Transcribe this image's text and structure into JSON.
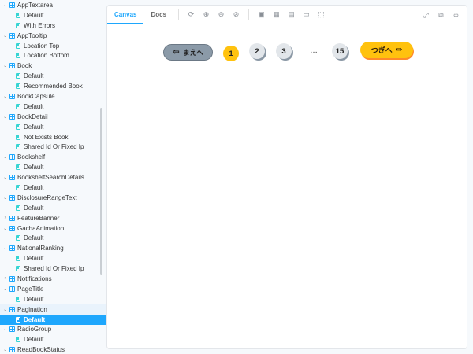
{
  "sidebar": {
    "items": [
      {
        "type": "component",
        "label": "AppTextarea"
      },
      {
        "type": "story",
        "label": "Default"
      },
      {
        "type": "story",
        "label": "With Errors"
      },
      {
        "type": "component",
        "label": "AppTooltip"
      },
      {
        "type": "story",
        "label": "Location Top"
      },
      {
        "type": "story",
        "label": "Location Bottom"
      },
      {
        "type": "component",
        "label": "Book"
      },
      {
        "type": "story",
        "label": "Default"
      },
      {
        "type": "story",
        "label": "Recommended Book"
      },
      {
        "type": "component",
        "label": "BookCapsule"
      },
      {
        "type": "story",
        "label": "Default"
      },
      {
        "type": "component",
        "label": "BookDetail"
      },
      {
        "type": "story",
        "label": "Default"
      },
      {
        "type": "story",
        "label": "Not Exists Book"
      },
      {
        "type": "story",
        "label": "Shared Id Or Fixed Ip"
      },
      {
        "type": "component",
        "label": "Bookshelf"
      },
      {
        "type": "story",
        "label": "Default"
      },
      {
        "type": "component",
        "label": "BookshelfSearchDetails"
      },
      {
        "type": "story",
        "label": "Default"
      },
      {
        "type": "component",
        "label": "DisclosureRangeText"
      },
      {
        "type": "story",
        "label": "Default"
      },
      {
        "type": "component",
        "label": "FeatureBanner",
        "collapsed": true
      },
      {
        "type": "component",
        "label": "GachaAnimation"
      },
      {
        "type": "story",
        "label": "Default"
      },
      {
        "type": "component",
        "label": "NationalRanking"
      },
      {
        "type": "story",
        "label": "Default"
      },
      {
        "type": "story",
        "label": "Shared Id Or Fixed Ip"
      },
      {
        "type": "component",
        "label": "Notifications",
        "collapsed": true
      },
      {
        "type": "component",
        "label": "PageTitle"
      },
      {
        "type": "story",
        "label": "Default"
      },
      {
        "type": "component",
        "label": "Pagination",
        "active": true
      },
      {
        "type": "story",
        "label": "Default",
        "selected": true
      },
      {
        "type": "component",
        "label": "RadioGroup"
      },
      {
        "type": "story",
        "label": "Default"
      },
      {
        "type": "component",
        "label": "ReadBookStatus"
      }
    ]
  },
  "toolbar": {
    "tabs": [
      {
        "label": "Canvas",
        "active": true
      },
      {
        "label": "Docs",
        "active": false
      }
    ],
    "tools": [
      "refresh-icon",
      "zoom-in-icon",
      "zoom-out-icon",
      "zoom-reset-icon",
      "background-icon",
      "grid-icon",
      "viewport-icon",
      "measure-icon",
      "outline-icon"
    ],
    "right_tools": [
      "fullscreen-icon",
      "open-new-tab-icon",
      "copy-link-icon"
    ]
  },
  "pagination": {
    "prev_label": "まえへ",
    "next_label": "つぎへ",
    "current_page": "1",
    "pages": [
      "2",
      "3"
    ],
    "ellipsis": "…",
    "last_page": "15"
  },
  "colors": {
    "accent": "#1ea7fd",
    "pagination_yellow": "#ffc20e",
    "pagination_gray": "#8b9aa8"
  }
}
